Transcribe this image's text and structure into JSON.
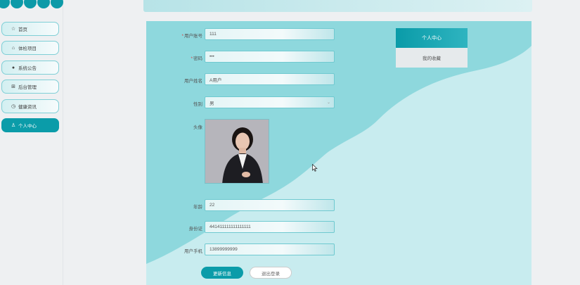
{
  "sidebar": {
    "items": [
      {
        "label": "首页",
        "icon": "star-icon",
        "glyph": "☆",
        "active": false
      },
      {
        "label": "体检项目",
        "icon": "bag-icon",
        "glyph": "⌂",
        "active": false
      },
      {
        "label": "系统公告",
        "icon": "info-icon",
        "glyph": "●",
        "active": false
      },
      {
        "label": "后台管理",
        "icon": "grid-icon",
        "glyph": "⊞",
        "active": false
      },
      {
        "label": "健康资讯",
        "icon": "clock-icon",
        "glyph": "◷",
        "active": false
      },
      {
        "label": "个人中心",
        "icon": "user-icon",
        "glyph": "♙",
        "active": true
      }
    ]
  },
  "form": {
    "account_label": "用户账号",
    "account_value": "111",
    "password_label": "密码",
    "password_value": "•••",
    "name_label": "用户姓名",
    "name_value": "A用户",
    "gender_label": "性别",
    "gender_value": "男",
    "avatar_label": "头像",
    "age_label": "年龄",
    "age_value": "22",
    "idcard_label": "身份证",
    "idcard_value": "441411111111111111",
    "phone_label": "用户手机",
    "phone_value": "13899999999",
    "update_button": "更新信息",
    "logout_button": "退出登录"
  },
  "side_menu": {
    "title": "个人中心",
    "items": [
      "我的收藏"
    ]
  },
  "colors": {
    "accent": "#0b9ca9",
    "panel_bg": "#8ed8dd",
    "wave_light": "#c8ecef"
  }
}
